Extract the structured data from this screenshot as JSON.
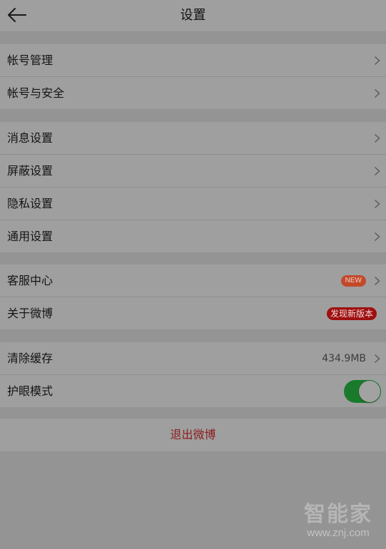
{
  "header": {
    "title": "设置"
  },
  "groups": [
    {
      "items": [
        {
          "label": "帐号管理"
        },
        {
          "label": "帐号与安全"
        }
      ]
    },
    {
      "items": [
        {
          "label": "消息设置"
        },
        {
          "label": "屏蔽设置"
        },
        {
          "label": "隐私设置"
        },
        {
          "label": "通用设置"
        }
      ]
    },
    {
      "items": [
        {
          "label": "客服中心",
          "badge": "NEW"
        },
        {
          "label": "关于微博",
          "badge": "发现新版本"
        }
      ]
    },
    {
      "items": [
        {
          "label": "清除缓存",
          "value": "434.9MB"
        },
        {
          "label": "护眼模式",
          "toggle_on": true
        }
      ]
    }
  ],
  "logout_label": "退出微博",
  "watermark": {
    "logo": "智能家",
    "url": "www.znj.com"
  },
  "colors": {
    "overlay_background": "#949494",
    "row_background": "#9f9f9f",
    "logout_text": "#8c1d1d",
    "toggle_on": "#197a2c",
    "new_badge": "#c2492a",
    "update_badge": "#9e1010"
  }
}
